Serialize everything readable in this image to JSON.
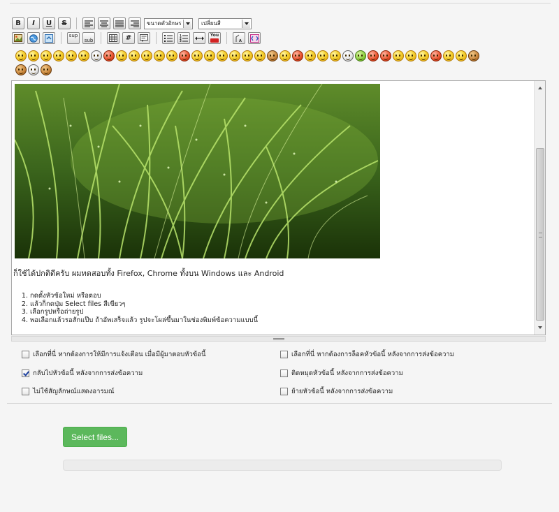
{
  "toolbar": {
    "bold": "B",
    "italic": "I",
    "underline": "U",
    "strike": "S",
    "sup": "sup",
    "sub": "sub",
    "hash": "#",
    "font_size_select": "ขนาดตัวอักษร",
    "color_select": "เปลี่ยนสี",
    "youtube": "You"
  },
  "icons": [
    "bold-icon",
    "italic-icon",
    "underline-icon",
    "strikethrough-icon",
    "align-left-icon",
    "align-center-icon",
    "align-justify-icon",
    "align-right-icon",
    "image-icon",
    "web-icon",
    "link-icon",
    "table-icon",
    "code-icon",
    "quote-icon",
    "bullet-list-icon",
    "numbered-list-icon",
    "horizontal-rule-icon",
    "youtube-icon",
    "spoiler-icon",
    "html-icon"
  ],
  "emoticon_count_row1": 37,
  "emoticon_count_row2": 3,
  "editor": {
    "line1": "ก็ใช้ได้ปกติดีครับ ผมทดสอบทั้ง Firefox, Chrome ทั้งบน Windows และ Android",
    "steps": [
      "กดตั้งหัวข้อใหม่ หรือตอบ",
      "แล้วก็กดปุ่ม Select files สีเขียวๆ",
      "เลือกรูปหรือถ่ายรูป",
      "พอเลือกแล้วรอสักแป๊บ ถ้าอัพเสร็จแล้ว รูปจะโผล่ขึ้นมาในช่องพิมพ์ข้อความแบบนี้"
    ]
  },
  "options": {
    "left": [
      {
        "label": "เลือกที่นี่ หากต้องการให้มีการแจ้งเตือน เมื่อมีผู้มาตอบหัวข้อนี้",
        "checked": false
      },
      {
        "label": "กลับไปหัวข้อนี้ หลังจากการส่งข้อความ",
        "checked": true
      },
      {
        "label": "ไม่ใช้สัญลักษณ์แสดงอารมณ์",
        "checked": false
      }
    ],
    "right": [
      {
        "label": "เลือกที่นี่ หากต้องการล็อคหัวข้อนี้ หลังจากการส่งข้อความ",
        "checked": false
      },
      {
        "label": "ติดหมุดหัวข้อนี้ หลังจากการส่งข้อความ",
        "checked": false
      },
      {
        "label": "ย้ายหัวข้อนี้ หลังจากการส่งข้อความ",
        "checked": false
      }
    ]
  },
  "upload": {
    "button_label": "Select files...",
    "button_color": "#5cb85c"
  }
}
